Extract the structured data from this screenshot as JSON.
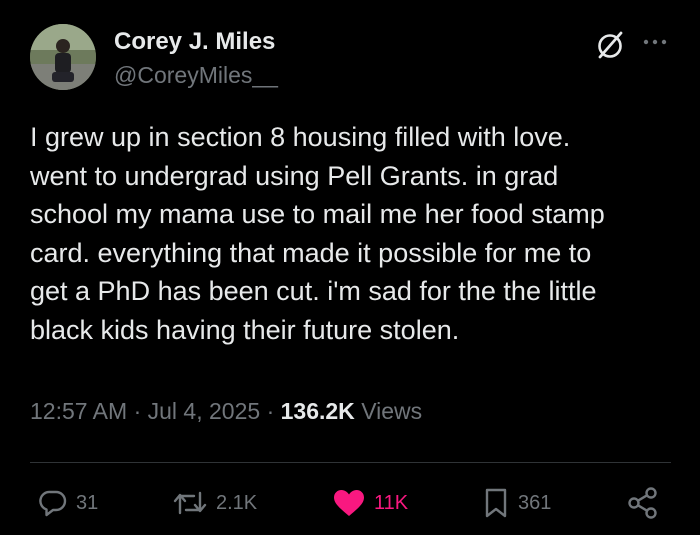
{
  "author": {
    "display_name": "Corey J. Miles",
    "handle": "@CoreyMiles__"
  },
  "header": {
    "grok_icon": "grok-slash-circle-icon",
    "more_icon": "more-dots-icon"
  },
  "tweet": {
    "text": "I grew up in section 8 housing filled with love.\nwent to undergrad using Pell Grants. in grad\nschool my mama use to mail me her food stamp\ncard. everything that made it possible for me to\nget a PhD has  been cut. i'm sad for the the little\nblack kids having their future stolen."
  },
  "meta": {
    "time": "12:57 AM",
    "separator": "·",
    "date": "Jul 4, 2025",
    "views_count": "136.2K",
    "views_label": "Views"
  },
  "actions": {
    "reply": {
      "icon": "reply-bubble-icon",
      "count": "31"
    },
    "retweet": {
      "icon": "retweet-icon",
      "count": "2.1K"
    },
    "like": {
      "icon": "heart-filled-icon",
      "count": "11K",
      "liked": true
    },
    "bookmark": {
      "icon": "bookmark-icon",
      "count": "361"
    },
    "share": {
      "icon": "share-icon"
    }
  },
  "colors": {
    "background": "#000000",
    "primary_text": "#e7e9ea",
    "secondary_text": "#71767b",
    "divider": "#2f3336",
    "like_pink": "#f91880"
  }
}
